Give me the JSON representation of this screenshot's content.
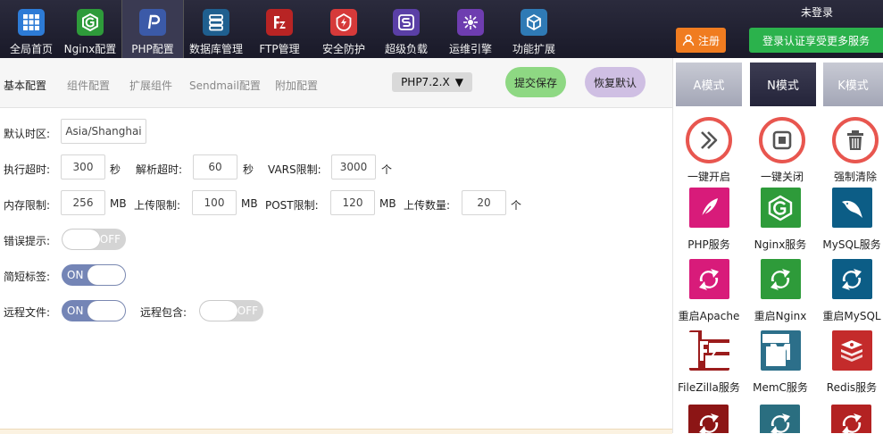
{
  "nav": {
    "items": [
      {
        "label": "全局首页",
        "icon": "grid-icon",
        "color": "#2d7bd6"
      },
      {
        "label": "Nginx配置",
        "icon": "nginx-icon",
        "color": "#2e9b3a"
      },
      {
        "label": "PHP配置",
        "icon": "php-icon",
        "color": "#3b5aa8"
      },
      {
        "label": "数据库管理",
        "icon": "database-icon",
        "color": "#1f5f8f"
      },
      {
        "label": "FTP管理",
        "icon": "filezilla-icon",
        "color": "#b82424"
      },
      {
        "label": "安全防护",
        "icon": "shield-icon",
        "color": "#d63a3a"
      },
      {
        "label": "超级负载",
        "icon": "load-icon",
        "color": "#5a3fa6"
      },
      {
        "label": "运维引擎",
        "icon": "engine-icon",
        "color": "#6e3db0"
      },
      {
        "label": "功能扩展",
        "icon": "box-icon",
        "color": "#2f7ab5"
      }
    ],
    "active_index": 2,
    "login_status": "未登录",
    "register_label": "注册",
    "login_share_label": "登录认证享受更多服务"
  },
  "subtabs": {
    "items": [
      "基本配置",
      "组件配置",
      "扩展组件",
      "Sendmail配置",
      "附加配置"
    ],
    "active_index": 0,
    "php_version": "PHP7.2.X",
    "save_label": "提交保存",
    "reset_label": "恢复默认"
  },
  "form": {
    "timezone_label": "默认时区:",
    "timezone_value": "Asia/Shanghai",
    "exec_timeout_label": "执行超时:",
    "exec_timeout_value": "300",
    "exec_timeout_unit": "秒",
    "parse_timeout_label": "解析超时:",
    "parse_timeout_value": "60",
    "parse_timeout_unit": "秒",
    "vars_limit_label": "VARS限制:",
    "vars_limit_value": "3000",
    "vars_limit_unit": "个",
    "memory_limit_label": "内存限制:",
    "memory_limit_value": "256",
    "memory_limit_unit": "MB",
    "upload_limit_label": "上传限制:",
    "upload_limit_value": "100",
    "upload_limit_unit": "MB",
    "post_limit_label": "POST限制:",
    "post_limit_value": "120",
    "post_limit_unit": "MB",
    "upload_count_label": "上传数量:",
    "upload_count_value": "20",
    "upload_count_unit": "个",
    "error_display_label": "错误提示:",
    "error_display_state": "OFF",
    "short_tags_label": "简短标签:",
    "short_tags_state": "ON",
    "remote_file_label": "远程文件:",
    "remote_file_state": "ON",
    "remote_include_label": "远程包含:",
    "remote_include_state": "OFF"
  },
  "modes": {
    "items": [
      "A模式",
      "N模式",
      "K模式"
    ],
    "active_index": 1
  },
  "actions": {
    "items": [
      {
        "label": "一键开启",
        "icon": "play-icon"
      },
      {
        "label": "一键关闭",
        "icon": "stop-icon"
      },
      {
        "label": "强制清除",
        "icon": "trash-icon"
      }
    ],
    "ring_color": "#e8564f"
  },
  "services": {
    "items": [
      {
        "label": "PHP服务",
        "icon": "feather-icon",
        "color": "#d81b7a"
      },
      {
        "label": "Nginx服务",
        "icon": "nginx-icon",
        "color": "#2e9b3a"
      },
      {
        "label": "MySQL服务",
        "icon": "dolphin-icon",
        "color": "#0c5d86"
      },
      {
        "label": "重启Apache",
        "icon": "restart-icon",
        "color": "#d81b7a"
      },
      {
        "label": "重启Nginx",
        "icon": "restart-icon",
        "color": "#2e9b3a"
      },
      {
        "label": "重启MySQL",
        "icon": "restart-icon",
        "color": "#0c5d86"
      },
      {
        "label": "FileZilla服务",
        "icon": "filezilla-icon",
        "color": "#9b1c1c"
      },
      {
        "label": "MemC服务",
        "icon": "memcache-icon",
        "color": "#2c6f8a"
      },
      {
        "label": "Redis服务",
        "icon": "redis-icon",
        "color": "#c42b2b"
      }
    ],
    "partial_row_colors": [
      "#8c1515",
      "#2a6e80",
      "#b32222"
    ]
  }
}
